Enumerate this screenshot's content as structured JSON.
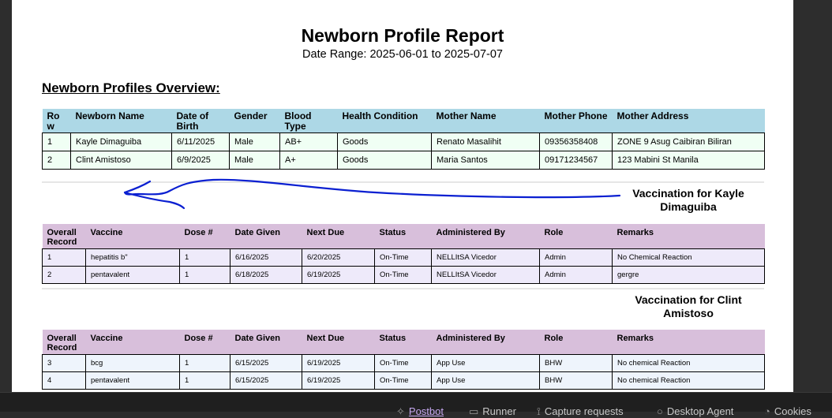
{
  "report": {
    "title": "Newborn Profile Report",
    "date_range": "Date Range: 2025-06-01 to 2025-07-07"
  },
  "newborn_section": {
    "title": "Newborn Profiles Overview:",
    "headers": [
      "Row",
      "Newborn Name",
      "Date of Birth",
      "Gender",
      "Blood Type",
      "Health Condition",
      "Mother Name",
      "Mother Phone",
      "Mother Address"
    ],
    "rows": [
      [
        "1",
        "Kayle Dimaguiba",
        "6/11/2025",
        "Male",
        "AB+",
        "Goods",
        "Renato Masalihit",
        "09356358408",
        "ZONE 9  Asug Caibiran Biliran"
      ],
      [
        "2",
        "Clint Amistoso",
        "6/9/2025",
        "Male",
        "A+",
        "Goods",
        "Maria Santos",
        "09171234567",
        "123 Mabini St Manila"
      ]
    ]
  },
  "vaccination_sections": [
    {
      "heading": "Vaccination for Kayle Dimaguiba",
      "headers": [
        "Overall Record",
        "Vaccine",
        "Dose #",
        "Date Given",
        "Next Due",
        "Status",
        "Administered By",
        "Role",
        "Remarks"
      ],
      "rows": [
        [
          "1",
          "hepatitis b\"",
          "1",
          "6/16/2025",
          "6/20/2025",
          "On-Time",
          "NELLItSA Vicedor",
          "Admin",
          "No Chemical Reaction"
        ],
        [
          "2",
          "pentavalent",
          "1",
          "6/18/2025",
          "6/19/2025",
          "On-Time",
          "NELLItSA Vicedor",
          "Admin",
          "gergre"
        ]
      ]
    },
    {
      "heading": "Vaccination for Clint Amistoso",
      "headers": [
        "Overall Record",
        "Vaccine",
        "Dose #",
        "Date Given",
        "Next Due",
        "Status",
        "Administered By",
        "Role",
        "Remarks"
      ],
      "rows": [
        [
          "3",
          "bcg",
          "1",
          "6/15/2025",
          "6/19/2025",
          "On-Time",
          "App Use",
          "BHW",
          "No chemical Reaction"
        ],
        [
          "4",
          "pentavalent",
          "1",
          "6/15/2025",
          "6/19/2025",
          "On-Time",
          "App Use",
          "BHW",
          "No chemical Reaction"
        ]
      ]
    }
  ],
  "status_bar": {
    "tabs": [
      {
        "label": "Postbot",
        "icon": "postbot-icon"
      },
      {
        "label": "Runner",
        "icon": "runner-icon"
      },
      {
        "label": "Capture requests",
        "icon": "capture-icon"
      },
      {
        "label": "Desktop Agent",
        "icon": "agent-icon"
      },
      {
        "label": "Cookies",
        "icon": "cookie-icon"
      }
    ]
  },
  "colors": {
    "newborn_header": "#add8e6",
    "newborn_row": "#f0fff4",
    "vaccination_header": "#d8bfdb",
    "annotation_ink": "#0a1fd1"
  }
}
